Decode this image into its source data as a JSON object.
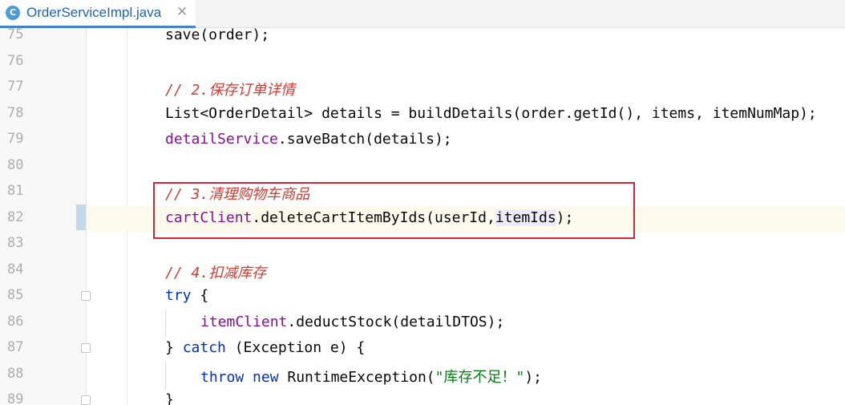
{
  "tab": {
    "icon_letter": "C",
    "title": "OrderServiceImpl.java",
    "close": "✕"
  },
  "lines": [
    {
      "num": "75",
      "segments": [
        {
          "t": "save(order);"
        }
      ]
    },
    {
      "num": "76",
      "segments": []
    },
    {
      "num": "77",
      "segments": [
        {
          "t": "// 2.",
          "c": "cmt"
        },
        {
          "t": "保存订单详情",
          "c": "cmt cjk"
        }
      ]
    },
    {
      "num": "78",
      "segments": [
        {
          "t": "List<OrderDetail> details = buildDetails(order.getId(), items, itemNumMap);"
        }
      ]
    },
    {
      "num": "79",
      "segments": [
        {
          "t": "detailService",
          "c": "fld"
        },
        {
          "t": ".saveBatch(details);"
        }
      ]
    },
    {
      "num": "80",
      "segments": []
    },
    {
      "num": "81",
      "segments": [
        {
          "t": "// 3.",
          "c": "cmt"
        },
        {
          "t": "清理购物车商品",
          "c": "cmt cjk"
        }
      ]
    },
    {
      "num": "82",
      "segments": [
        {
          "t": "cartClient",
          "c": "fld"
        },
        {
          "t": ".deleteCartItemByIds(userId,"
        },
        {
          "t": "itemIds",
          "c": "hl"
        },
        {
          "t": ");"
        }
      ]
    },
    {
      "num": "83",
      "segments": []
    },
    {
      "num": "84",
      "segments": [
        {
          "t": "// 4.",
          "c": "cmt"
        },
        {
          "t": "扣减库存",
          "c": "cmt cjk"
        }
      ]
    },
    {
      "num": "85",
      "segments": [
        {
          "t": "try",
          "c": "kw"
        },
        {
          "t": " {"
        }
      ]
    },
    {
      "num": "86",
      "segments": [
        {
          "t": "itemClient",
          "c": "fld"
        },
        {
          "t": ".deductStock(detailDTOS);"
        }
      ]
    },
    {
      "num": "87",
      "segments": [
        {
          "t": "} "
        },
        {
          "t": "catch",
          "c": "kw"
        },
        {
          "t": " (Exception e) {"
        }
      ]
    },
    {
      "num": "88",
      "segments": [
        {
          "t": "throw",
          "c": "kw"
        },
        {
          "t": " "
        },
        {
          "t": "new",
          "c": "kw"
        },
        {
          "t": " RuntimeException("
        },
        {
          "t": "\"库存不足！\"",
          "c": "str"
        },
        {
          "t": ");"
        }
      ]
    },
    {
      "num": "89",
      "segments": [
        {
          "t": "}"
        }
      ]
    }
  ]
}
